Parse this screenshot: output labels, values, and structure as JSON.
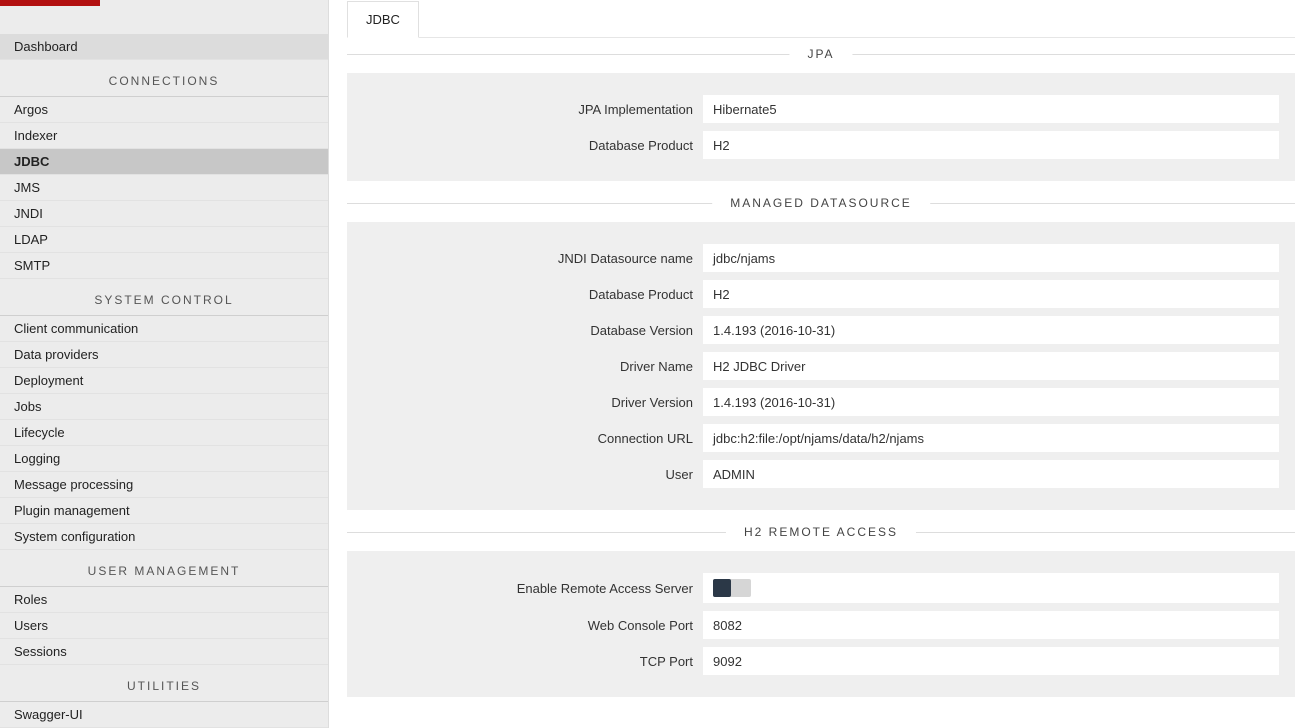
{
  "sidebar": {
    "dashboard": "Dashboard",
    "sections": [
      {
        "title": "CONNECTIONS",
        "items": [
          "Argos",
          "Indexer",
          "JDBC",
          "JMS",
          "JNDI",
          "LDAP",
          "SMTP"
        ],
        "active_index": 2
      },
      {
        "title": "SYSTEM CONTROL",
        "items": [
          "Client communication",
          "Data providers",
          "Deployment",
          "Jobs",
          "Lifecycle",
          "Logging",
          "Message processing",
          "Plugin management",
          "System configuration"
        ],
        "active_index": -1
      },
      {
        "title": "USER MANAGEMENT",
        "items": [
          "Roles",
          "Users",
          "Sessions"
        ],
        "active_index": -1
      },
      {
        "title": "UTILITIES",
        "items": [
          "Swagger-UI"
        ],
        "active_index": -1
      }
    ]
  },
  "tabs": {
    "items": [
      "JDBC"
    ],
    "active_index": 0
  },
  "groups": [
    {
      "legend": "JPA",
      "rows": [
        {
          "label": "JPA Implementation",
          "type": "text",
          "value": "Hibernate5"
        },
        {
          "label": "Database Product",
          "type": "text",
          "value": "H2"
        }
      ]
    },
    {
      "legend": "MANAGED DATASOURCE",
      "rows": [
        {
          "label": "JNDI Datasource name",
          "type": "text",
          "value": "jdbc/njams"
        },
        {
          "label": "Database Product",
          "type": "text",
          "value": "H2"
        },
        {
          "label": "Database Version",
          "type": "text",
          "value": "1.4.193 (2016-10-31)"
        },
        {
          "label": "Driver Name",
          "type": "text",
          "value": "H2 JDBC Driver"
        },
        {
          "label": "Driver Version",
          "type": "text",
          "value": "1.4.193 (2016-10-31)"
        },
        {
          "label": "Connection URL",
          "type": "text",
          "value": "jdbc:h2:file:/opt/njams/data/h2/njams"
        },
        {
          "label": "User",
          "type": "text",
          "value": "ADMIN"
        }
      ]
    },
    {
      "legend": "H2 REMOTE ACCESS",
      "rows": [
        {
          "label": "Enable Remote Access Server",
          "type": "toggle",
          "value": false
        },
        {
          "label": "Web Console Port",
          "type": "text",
          "value": "8082"
        },
        {
          "label": "TCP Port",
          "type": "text",
          "value": "9092"
        }
      ]
    }
  ]
}
